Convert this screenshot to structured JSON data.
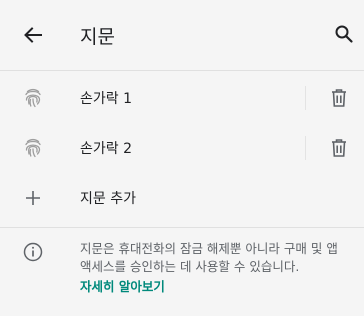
{
  "appbar": {
    "title": "지문",
    "back_icon": "arrow-back-icon",
    "search_icon": "search-icon"
  },
  "fingerprints": [
    {
      "label": "손가락 1",
      "icon": "fingerprint-icon",
      "action_icon": "trash-icon"
    },
    {
      "label": "손가락 2",
      "icon": "fingerprint-icon",
      "action_icon": "trash-icon"
    }
  ],
  "add": {
    "label": "지문 추가",
    "icon": "plus-icon"
  },
  "info": {
    "icon": "info-icon",
    "text": "지문은 휴대전화의 잠금 해제뿐 아니라 구매 및 앱 액세스를 승인하는 데 사용할 수 있습니다.",
    "link": "자세히 알아보기"
  },
  "colors": {
    "background": "#f5f5f5",
    "link": "#00897b",
    "icon": "#5f6368"
  }
}
